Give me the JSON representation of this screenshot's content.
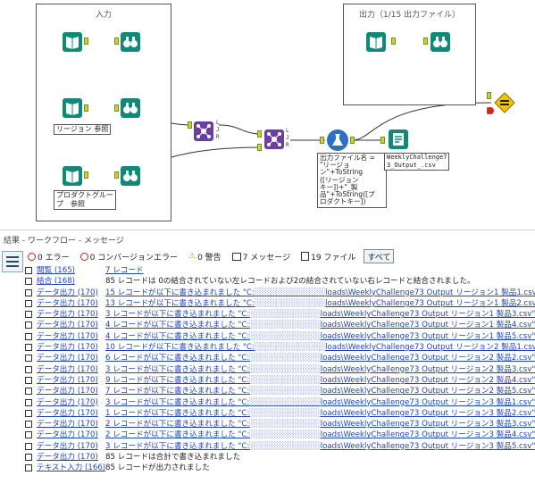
{
  "canvas": {
    "input_container": {
      "title": "入力"
    },
    "output_container": {
      "title": "出力（1/15 出力ファイル）"
    },
    "notes": {
      "region_ref": "リージョン 参照",
      "product_ref": "プロダクトグルー\nプ　参照",
      "formula": "出力ファイル名 =\n\"リージョ\nン\"+ToString\n([リージョン\nキー])+\"_製\n品\"+ToString([プ\nロダクトキー])",
      "output_file": "WeeklyChallenge7\n3_Output_.csv"
    },
    "join_anchors": [
      "L",
      "J",
      "R"
    ],
    "input_anchors": [
      "L",
      "R"
    ]
  },
  "panel": {
    "title": "結果 - ワークフロー - メッセージ",
    "toolbar": {
      "errors": "0 エラー",
      "conversion_errors": "0 コンバージョンエラー",
      "warnings": "0 警告",
      "messages": "7 メッセージ",
      "files": "19 ファイル",
      "all": "すべて"
    },
    "rows": [
      {
        "src": "閲覧 (165)",
        "msg": "7 レコード",
        "link": true
      },
      {
        "src": "結合 (168)",
        "msg": "85 レコードは 0の結合されていない左レコードおよび2の結合されていない右レコードと結合されました。",
        "link": false
      },
      {
        "src": "データ出力 (170)",
        "pre": "15 レコードが以下に書き込まれました \"C:",
        "post": "loads\\WeeklyChallenge73 Output リージョン1 製品1.csv\"",
        "link": true
      },
      {
        "src": "データ出力 (170)",
        "pre": "13 レコードが以下に書き込まれました \"C:",
        "post": "loads\\WeeklyChallenge73 Output リージョン1 製品2.csv\"",
        "link": true
      },
      {
        "src": "データ出力 (170)",
        "pre": "3 レコードが以下に書き込まれました \"C:",
        "post": "loads\\WeeklyChallenge73 Output リージョン1 製品3.csv\"",
        "link": true
      },
      {
        "src": "データ出力 (170)",
        "pre": "4 レコードが以下に書き込まれました \"C:",
        "post": "loads\\WeeklyChallenge73 Output リージョン1 製品4.csv\"",
        "link": true
      },
      {
        "src": "データ出力 (170)",
        "pre": "4 レコードが以下に書き込まれました \"C:",
        "post": "loads\\WeeklyChallenge73 Output リージョン1 製品5.csv\"",
        "link": true
      },
      {
        "src": "データ出力 (170)",
        "pre": "10 レコードが以下に書き込まれました \"C:",
        "post": "loads\\WeeklyChallenge73 Output リージョン2 製品1.csv\"",
        "link": true
      },
      {
        "src": "データ出力 (170)",
        "pre": "6 レコードが以下に書き込まれました \"C:",
        "post": "loads\\WeeklyChallenge73 Output リージョン2 製品2.csv\"",
        "link": true
      },
      {
        "src": "データ出力 (170)",
        "pre": "3 レコードが以下に書き込まれました \"C:",
        "post": "loads\\WeeklyChallenge73 Output リージョン2 製品3.csv\"",
        "link": true
      },
      {
        "src": "データ出力 (170)",
        "pre": "9 レコードが以下に書き込まれました \"C:",
        "post": "loads\\WeeklyChallenge73 Output リージョン2 製品4.csv\"",
        "link": true
      },
      {
        "src": "データ出力 (170)",
        "pre": "7 レコードが以下に書き込まれました \"C:",
        "post": "loads\\WeeklyChallenge73 Output リージョン2 製品5.csv\"",
        "link": true
      },
      {
        "src": "データ出力 (170)",
        "pre": "3 レコードが以下に書き込まれました \"C:",
        "post": "loads\\WeeklyChallenge73 Output リージョン3 製品1.csv\"",
        "link": true
      },
      {
        "src": "データ出力 (170)",
        "pre": "1 レコードが以下に書き込まれました \"C:",
        "post": "loads\\WeeklyChallenge73 Output リージョン3 製品2.csv\"",
        "link": true
      },
      {
        "src": "データ出力 (170)",
        "pre": "2 レコードが以下に書き込まれました \"C:",
        "post": "loads\\WeeklyChallenge73 Output リージョン3 製品3.csv\"",
        "link": true
      },
      {
        "src": "データ出力 (170)",
        "pre": "2 レコードが以下に書き込まれました \"C:",
        "post": "loads\\WeeklyChallenge73 Output リージョン3 製品4.csv\"",
        "link": true
      },
      {
        "src": "データ出力 (170)",
        "pre": "3 レコードが以下に書き込まれました \"C:",
        "post": "loads\\WeeklyChallenge73 Output リージョン3 製品5.csv\"",
        "link": true
      },
      {
        "src": "データ出力 (170)",
        "msg": "85 レコードは合計で書き込まれました",
        "link": false
      },
      {
        "src": "テキスト入力 (166)",
        "msg": "85 レコードが出力されました",
        "link": false
      }
    ]
  }
}
